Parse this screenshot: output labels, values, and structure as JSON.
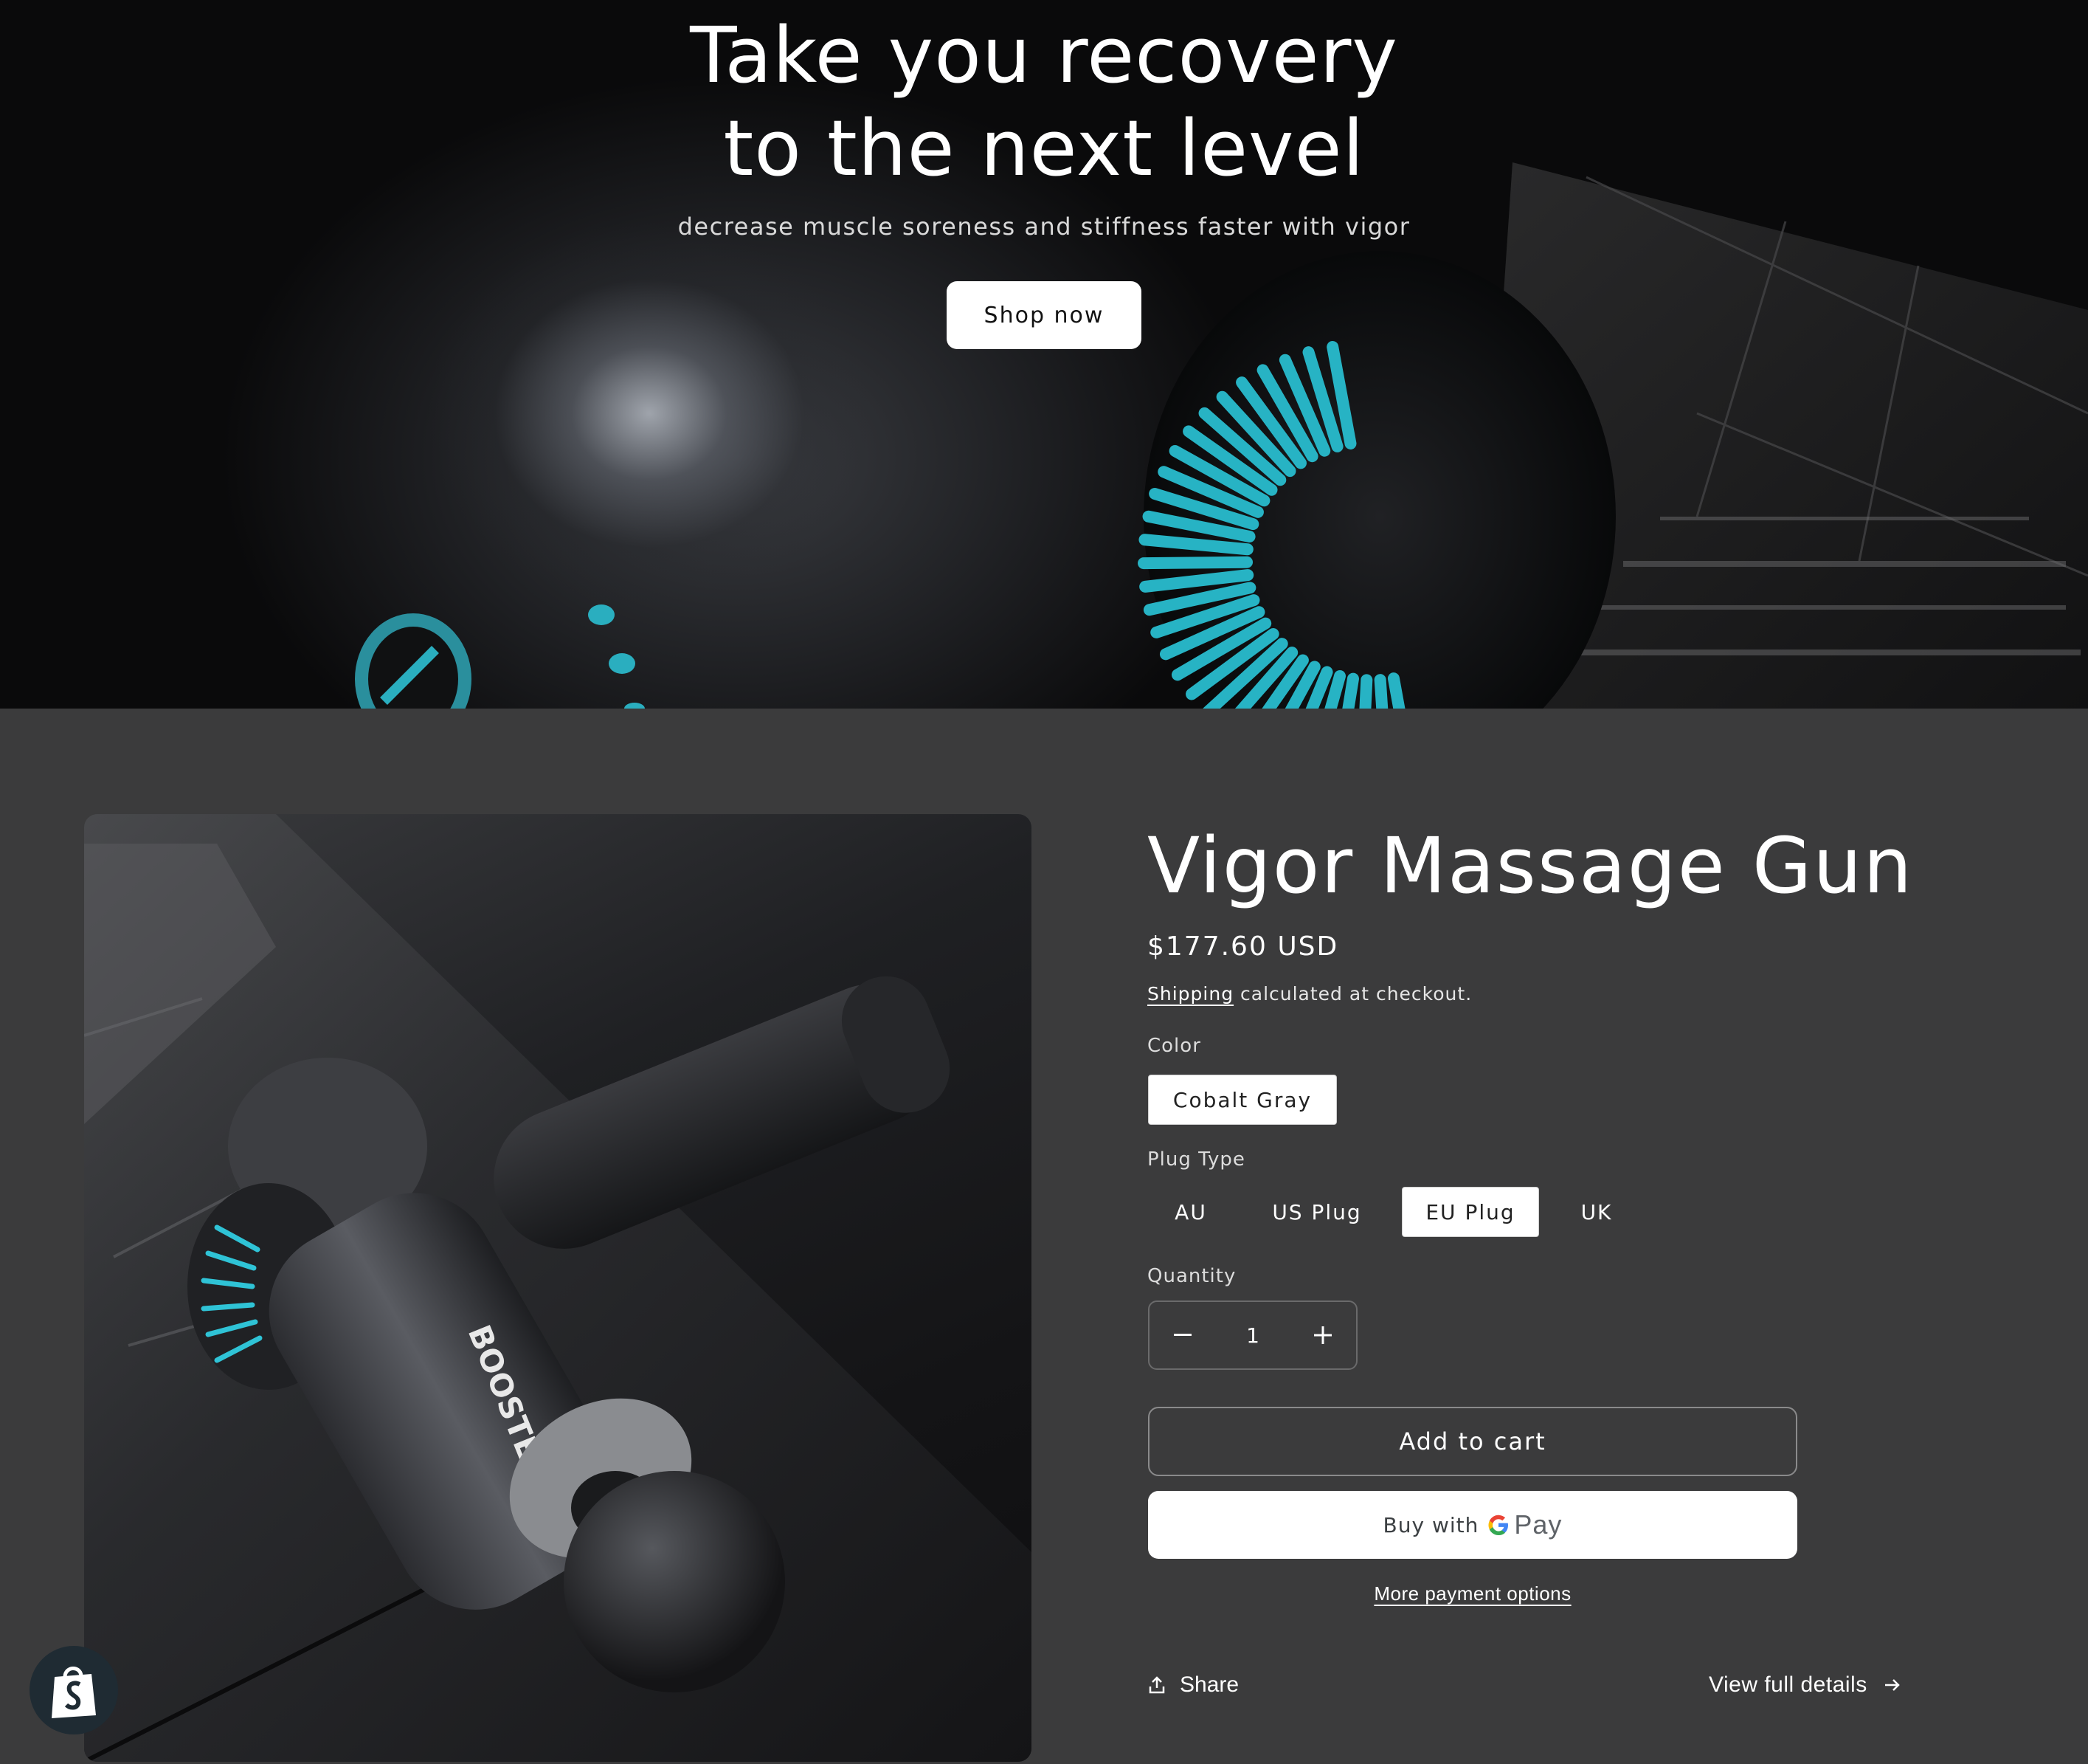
{
  "hero": {
    "title_line1": "Take you recovery",
    "title_line2": "to the next level",
    "subtitle": "decrease muscle soreness and stiffness faster with vigor",
    "cta_label": "Shop now"
  },
  "product": {
    "title": "Vigor Massage Gun",
    "price": "$177.60 USD",
    "shipping_link": "Shipping",
    "shipping_text": " calculated at checkout.",
    "image_brand_text": "BOOSTER",
    "color": {
      "label": "Color",
      "options": [
        "Cobalt Gray"
      ],
      "selected": "Cobalt Gray"
    },
    "plug": {
      "label": "Plug Type",
      "options": [
        "AU",
        "US Plug",
        "EU Plug",
        "UK"
      ],
      "selected": "EU Plug"
    },
    "quantity": {
      "label": "Quantity",
      "value": "1",
      "decrement_icon": "minus-icon",
      "increment_icon": "plus-icon"
    },
    "add_to_cart_label": "Add to cart",
    "gpay": {
      "prefix": "Buy with",
      "g_letter": "G",
      "pay_word": "Pay"
    },
    "more_payment_label": "More payment options",
    "share_label": "Share",
    "view_details_label": "View full details"
  },
  "colors": {
    "page_bg": "#3b3b3c",
    "accent_teal": "#27b3c4",
    "button_white": "#ffffff"
  },
  "icons": {
    "share": "share-icon",
    "arrow": "arrow-right-icon",
    "shopify": "shopify-bag-icon"
  }
}
